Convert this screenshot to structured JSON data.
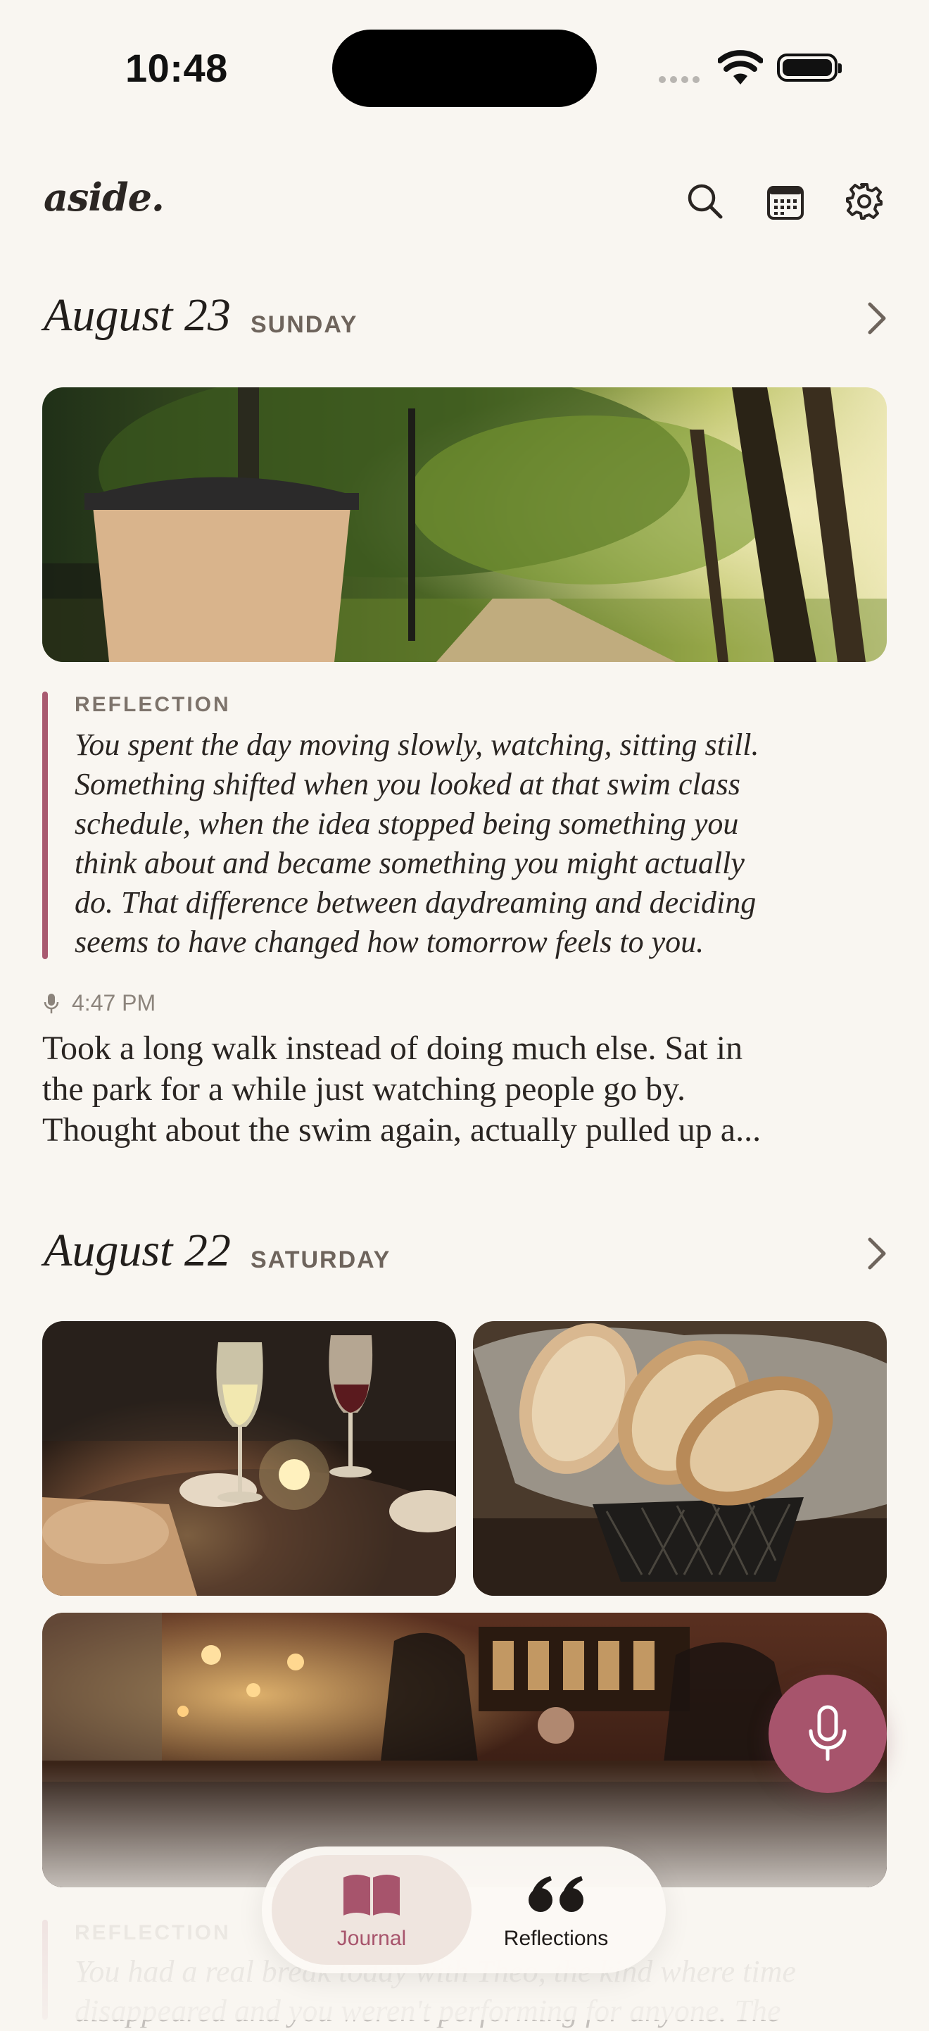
{
  "status_bar": {
    "time": "10:48"
  },
  "header": {
    "logo": "aside.",
    "icons": [
      "search-icon",
      "calendar-icon",
      "gear-icon"
    ]
  },
  "days": [
    {
      "date": "August 23",
      "weekday": "SUNDAY",
      "reflection": {
        "label": "REFLECTION",
        "lines": [
          "You spent the day moving slowly, watching, sitting still.",
          "Something shifted when you looked at that swim class",
          "schedule, when the idea stopped being something you",
          "think about and became something you might actually",
          "do. That difference between daydreaming and deciding",
          "seems to have changed how tomorrow feels to you."
        ]
      },
      "entry": {
        "time": "4:47 PM",
        "lines": [
          "Took a long walk instead of doing much else. Sat in",
          "the park for a while just watching people go by.",
          "Thought about the swim again, actually pulled up a..."
        ]
      }
    },
    {
      "date": "August 22",
      "weekday": "SATURDAY",
      "reflection": {
        "label": "REFLECTION",
        "lines": [
          "You had a real break today with Theo, the kind where time",
          "disappeared and you weren't performing for anyone. The"
        ]
      }
    }
  ],
  "tab_bar": {
    "journal_label": "Journal",
    "reflections_label": "Reflections"
  },
  "colors": {
    "accent": "#a7546c",
    "background": "#f9f6f1",
    "text": "#2a2522"
  }
}
